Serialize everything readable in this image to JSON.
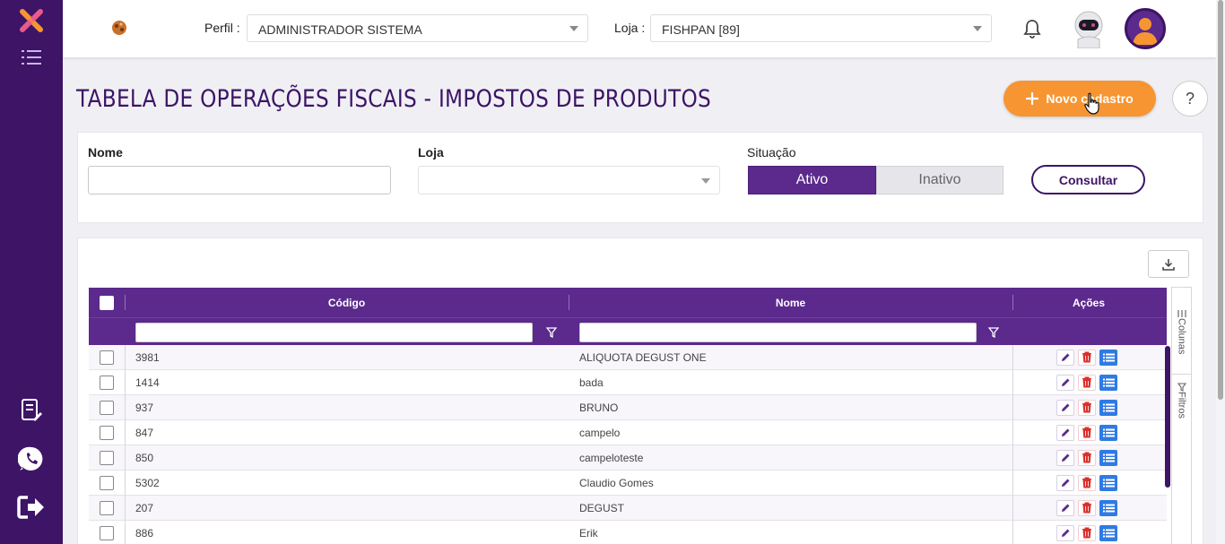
{
  "topbar": {
    "profile_label": "Perfil :",
    "profile_value": "ADMINISTRADOR SISTEMA",
    "store_label": "Loja :",
    "store_value": "FISHPAN [89]"
  },
  "page": {
    "title": "TABELA DE OPERAÇÕES FISCAIS - IMPOSTOS DE PRODUTOS",
    "new_button": "Novo cadastro",
    "help_button": "?"
  },
  "filters": {
    "name_label": "Nome",
    "store_label": "Loja",
    "status_label": "Situação",
    "active_label": "Ativo",
    "inactive_label": "Inativo",
    "consult_button": "Consultar"
  },
  "grid": {
    "columns": {
      "code": "Código",
      "name": "Nome",
      "actions": "Ações"
    },
    "side_tabs": {
      "columns": "Colunas",
      "filters": "Filtros"
    },
    "rows": [
      {
        "code": "3981",
        "name": "ALIQUOTA DEGUST ONE"
      },
      {
        "code": "1414",
        "name": "bada"
      },
      {
        "code": "937",
        "name": "BRUNO"
      },
      {
        "code": "847",
        "name": "campelo"
      },
      {
        "code": "850",
        "name": "campeloteste"
      },
      {
        "code": "5302",
        "name": "Claudio Gomes"
      },
      {
        "code": "207",
        "name": "DEGUST"
      },
      {
        "code": "886",
        "name": "Erik"
      }
    ]
  },
  "colors": {
    "brand_purple": "#3d1466",
    "header_purple": "#5b2a8c",
    "accent_orange": "#f79533",
    "detail_blue": "#2f7ae5",
    "delete_red": "#d9302c"
  },
  "icons": {
    "sidebar_logo": "x-logo-icon",
    "menu": "hamburger-menu-icon",
    "notes": "document-edit-icon",
    "whatsapp": "whatsapp-icon",
    "logout": "logout-icon",
    "bell": "bell-icon",
    "avatar": "robot-avatar",
    "user": "user-icon",
    "export": "download-icon",
    "filter": "funnel-icon",
    "edit": "pencil-icon",
    "delete": "trash-icon",
    "details": "list-icon"
  }
}
